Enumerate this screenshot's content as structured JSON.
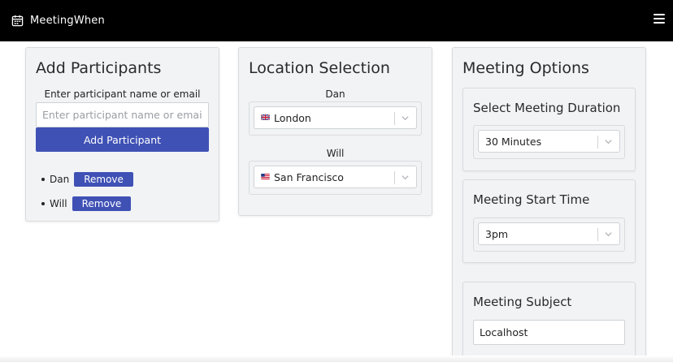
{
  "app": {
    "title": "MeetingWhen"
  },
  "participants": {
    "title": "Add Participants",
    "input_label": "Enter participant name or email",
    "input_placeholder": "Enter participant name or email",
    "add_button": "Add Participant",
    "remove_label": "Remove",
    "list": [
      {
        "name": "Dan"
      },
      {
        "name": "Will"
      }
    ]
  },
  "location": {
    "title": "Location Selection",
    "entries": [
      {
        "participant": "Dan",
        "city": "London",
        "flag": "uk-flag-icon"
      },
      {
        "participant": "Will",
        "city": "San Francisco",
        "flag": "us-flag-icon"
      }
    ]
  },
  "options": {
    "title": "Meeting Options",
    "duration": {
      "title": "Select Meeting Duration",
      "value": "30 Minutes"
    },
    "start_time": {
      "title": "Meeting Start Time",
      "value": "3pm"
    },
    "subject": {
      "title": "Meeting Subject",
      "value": "Localhost"
    }
  },
  "icons": {
    "brand": "calendar-icon",
    "menu": "hamburger-menu-icon",
    "dropdown": "chevron-down-icon"
  },
  "colors": {
    "topbar": "#000000",
    "primary": "#3f51b5",
    "card_bg": "#f1f3f5"
  }
}
